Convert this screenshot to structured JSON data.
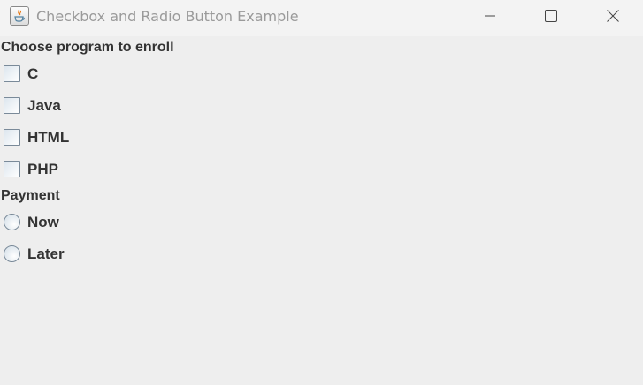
{
  "window": {
    "title": "Checkbox and Radio Button Example",
    "app_icon": "java-icon",
    "controls": [
      "minimize-icon",
      "maximize-icon",
      "close-icon"
    ]
  },
  "program_section": {
    "label": "Choose program to enroll",
    "options": [
      {
        "label": "C",
        "checked": false
      },
      {
        "label": "Java",
        "checked": false
      },
      {
        "label": "HTML",
        "checked": false
      },
      {
        "label": "PHP",
        "checked": false
      }
    ]
  },
  "payment_section": {
    "label": "Payment",
    "options": [
      {
        "label": "Now",
        "selected": false
      },
      {
        "label": "Later",
        "selected": false
      }
    ]
  }
}
